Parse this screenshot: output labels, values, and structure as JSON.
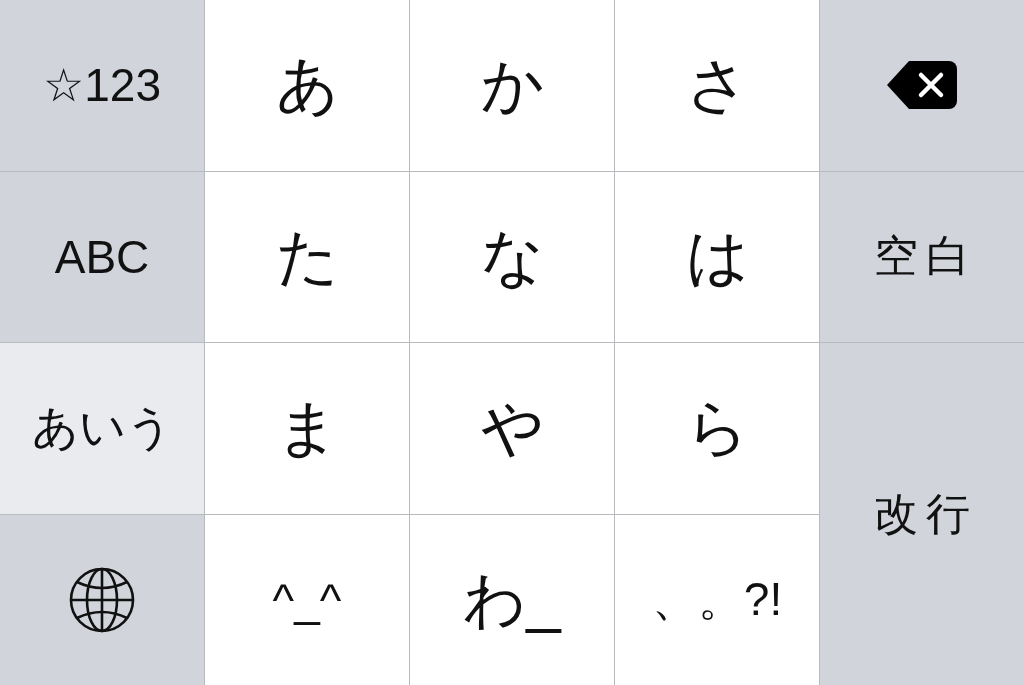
{
  "keyboard": {
    "keys": [
      {
        "kind": "mode",
        "label": "☆123",
        "selected": false
      },
      {
        "kind": "kana",
        "label": "あ"
      },
      {
        "kind": "kana",
        "label": "か"
      },
      {
        "kind": "kana",
        "label": "さ"
      },
      {
        "kind": "delete"
      },
      {
        "kind": "mode",
        "label": "ABC",
        "selected": false
      },
      {
        "kind": "kana",
        "label": "た"
      },
      {
        "kind": "kana",
        "label": "な"
      },
      {
        "kind": "kana",
        "label": "は"
      },
      {
        "kind": "space",
        "label": "空白"
      },
      {
        "kind": "mode",
        "label": "あいう",
        "selected": true
      },
      {
        "kind": "kana",
        "label": "ま"
      },
      {
        "kind": "kana",
        "label": "や"
      },
      {
        "kind": "kana",
        "label": "ら"
      },
      {
        "kind": "return",
        "label": "改行"
      },
      {
        "kind": "globe"
      },
      {
        "kind": "symbol",
        "label": "^_^"
      },
      {
        "kind": "kana",
        "label": "わ_"
      },
      {
        "kind": "symbol",
        "label": "、。?!"
      }
    ]
  }
}
